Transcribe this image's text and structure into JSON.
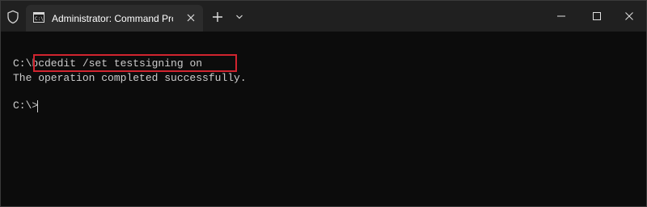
{
  "window": {
    "tab_title": "Administrator: Command Prom",
    "tab_icon": "cmd-icon",
    "titlebar_icon": "shield-icon",
    "buttons": [
      "new-tab-icon",
      "dropdown-chevron-icon",
      "minimize-icon",
      "maximize-icon",
      "close-icon"
    ]
  },
  "terminal": {
    "line1_prompt": "C:\\",
    "line1_command": "bcdedit /set testsigning on",
    "line2_output": "The operation completed successfully.",
    "line3_prompt": "C:\\>"
  },
  "colors": {
    "terminal_bg": "#0c0c0c",
    "titlebar_bg": "#202020",
    "tab_bg": "#2c2c2c",
    "text": "#cccccc",
    "highlight_box": "#d1242f"
  }
}
